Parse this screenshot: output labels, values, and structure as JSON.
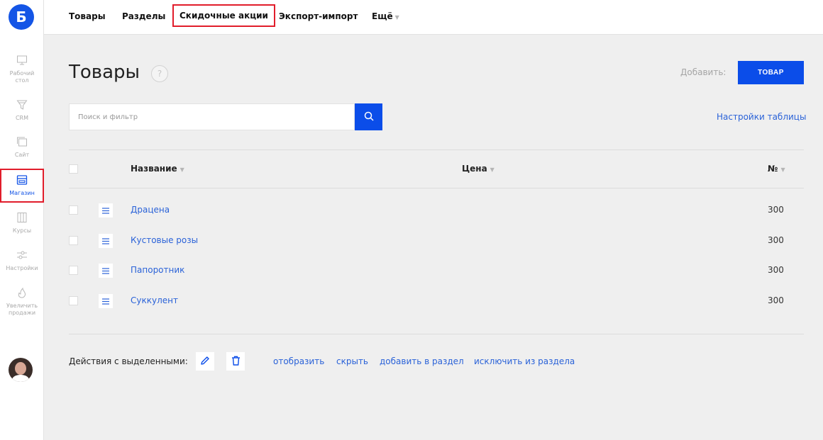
{
  "logo": {
    "letter": "Б"
  },
  "sidebar": {
    "items": [
      {
        "label": "Рабочий стол",
        "icon": "monitor-icon"
      },
      {
        "label": "CRM",
        "icon": "funnel-icon"
      },
      {
        "label": "Сайт",
        "icon": "pages-icon"
      },
      {
        "label": "Магазин",
        "icon": "shop-icon",
        "active": true
      },
      {
        "label": "Курсы",
        "icon": "books-icon"
      },
      {
        "label": "Настройки",
        "icon": "sliders-icon"
      },
      {
        "label": "Увеличить продажи",
        "icon": "fire-icon"
      }
    ]
  },
  "topnav": {
    "items": [
      {
        "label": "Товары"
      },
      {
        "label": "Разделы"
      },
      {
        "label": "Скидочные акции",
        "highlighted": true
      },
      {
        "label": "Экспорт-импорт"
      },
      {
        "label": "Ещё",
        "has_caret": true
      }
    ]
  },
  "page": {
    "title": "Товары",
    "help": "?",
    "add_label": "Добавить:",
    "add_button": "ТОВАР",
    "search_placeholder": "Поиск и фильтр",
    "table_settings": "Настройки таблицы"
  },
  "table": {
    "columns": [
      "Название",
      "Цена",
      "№"
    ],
    "rows": [
      {
        "name": "Драцена",
        "number": "300"
      },
      {
        "name": "Кустовые розы",
        "number": "300"
      },
      {
        "name": "Папоротник",
        "number": "300"
      },
      {
        "name": "Суккулент",
        "number": "300"
      }
    ]
  },
  "bulk_actions": {
    "label": "Действия с выделенными:",
    "links": [
      "отобразить",
      "скрыть",
      "добавить в раздел",
      "исключить из раздела"
    ]
  },
  "colors": {
    "accent": "#0b4de9",
    "link": "#2a62d8",
    "highlight_border": "#e11d2b",
    "background": "#efefef"
  }
}
